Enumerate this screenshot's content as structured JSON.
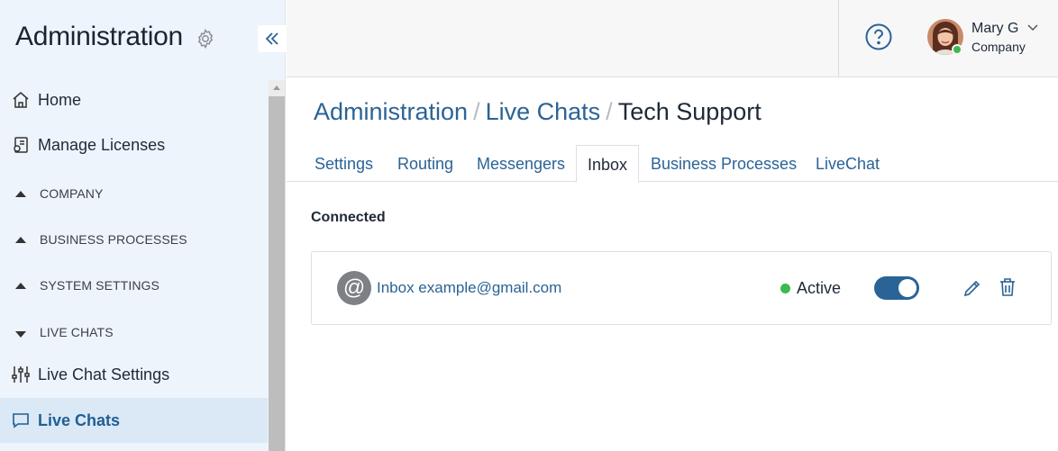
{
  "sidebar": {
    "title": "Administration",
    "collapse_icon": "double-chevron-left-icon",
    "items": [
      {
        "label": "Home",
        "icon": "home-icon"
      },
      {
        "label": "Manage Licenses",
        "icon": "license-icon"
      }
    ],
    "sections": [
      {
        "label": "COMPANY",
        "state": "collapsed"
      },
      {
        "label": "BUSINESS PROCESSES",
        "state": "collapsed"
      },
      {
        "label": "SYSTEM SETTINGS",
        "state": "collapsed"
      },
      {
        "label": "LIVE CHATS",
        "state": "expanded"
      }
    ],
    "sub_items": [
      {
        "label": "Live Chat Settings",
        "icon": "sliders-icon"
      },
      {
        "label": "Live Chats",
        "icon": "chat-bubble-icon",
        "active": true
      }
    ]
  },
  "header": {
    "help_icon": "help-circle-icon",
    "user": {
      "name": "Mary G",
      "company": "Company",
      "status_color": "#3fb950"
    }
  },
  "breadcrumb": {
    "items": [
      "Administration",
      "Live Chats"
    ],
    "current": "Tech Support",
    "separator": "/"
  },
  "tabs": [
    {
      "label": "Settings"
    },
    {
      "label": "Routing"
    },
    {
      "label": "Messengers"
    },
    {
      "label": "Inbox",
      "active": true
    },
    {
      "label": "Business Processes"
    },
    {
      "label": "LiveChat"
    }
  ],
  "connected": {
    "title": "Connected",
    "inbox": {
      "label": "Inbox example@gmail.com",
      "icon": "at-sign-icon",
      "status": "Active",
      "enabled": true
    }
  },
  "colors": {
    "accent": "#2a6396",
    "sidebar_bg": "#eef4fb",
    "active_bg": "#dbe8f5",
    "success": "#3fb950"
  }
}
